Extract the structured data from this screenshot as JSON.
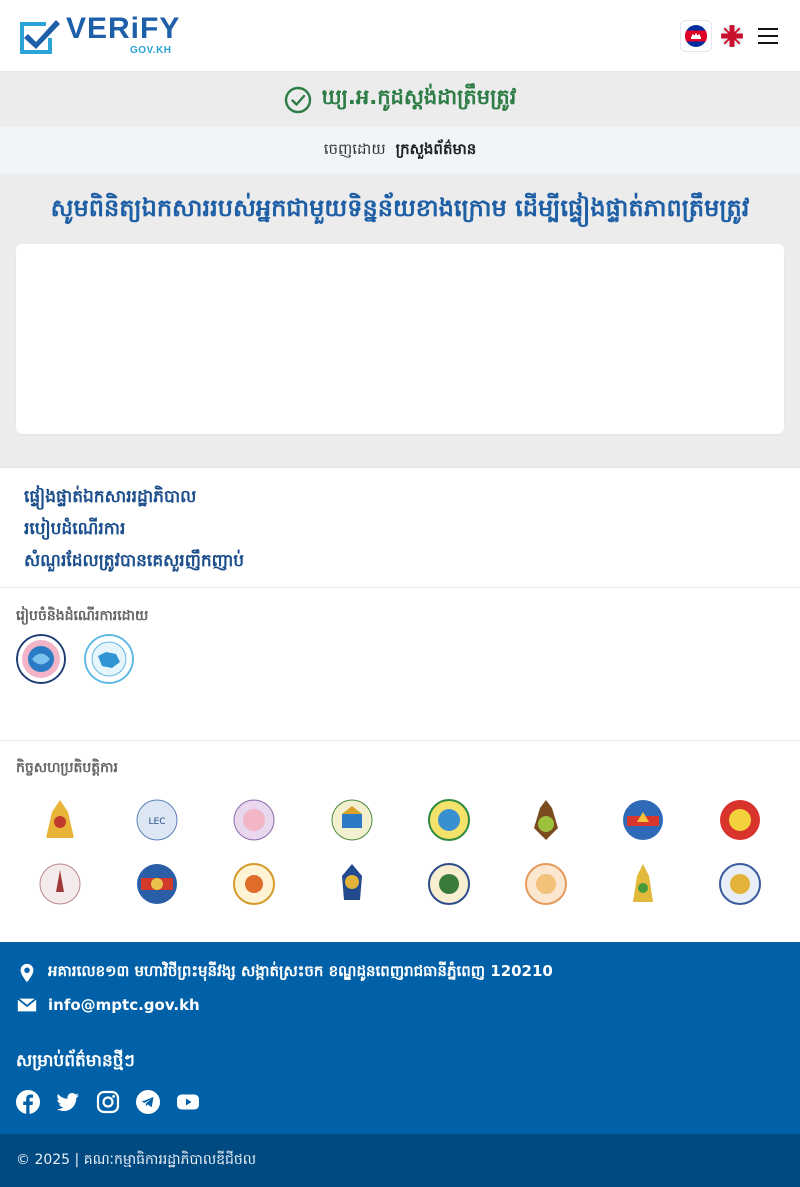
{
  "header": {
    "logo_text": "VERiFY",
    "logo_sub": "GOV.KH",
    "lang_kh": "flag-kh-icon",
    "lang_en": "flag-uk-icon"
  },
  "status": {
    "text": "ឃ្យ.អ.កូដស្តង់ដាត្រឹមត្រូវ",
    "color": "#2e7d46"
  },
  "issuer": {
    "label": "ចេញដោយ",
    "name": "ក្រសួងព័ត៌មាន"
  },
  "main": {
    "title": "សូមពិនិត្យឯកសាររបស់អ្នកជាមួយទិន្នន័យខាងក្រោម ដើម្បីផ្ទៀងផ្ទាត់ភាពត្រឹមត្រូវ"
  },
  "links": [
    "ផ្ទៀងផ្ទាត់ឯកសាររដ្ឋាភិបាល",
    "របៀបដំណើរការ",
    "សំណួរដែលត្រូវបានគេសួរញឹកញាប់"
  ],
  "developed_by": {
    "label": "រៀបចំនិងដំណើរការដោយ"
  },
  "partners": {
    "label": "កិច្ចសហប្រតិបត្តិការ"
  },
  "footer": {
    "address": "អគារលេខ១៣ មហាវិថីព្រះមុនីវង្ស សង្កាត់ស្រះចក ខណ្ឌដូនពេញរាជធានីភ្នំពេញ 120210",
    "email": "info@mptc.gov.kh",
    "follow_label": "សម្រាប់ព័ត៌មានថ្មីៗ",
    "socials": [
      "facebook-icon",
      "twitter-icon",
      "instagram-icon",
      "telegram-icon",
      "youtube-icon"
    ],
    "copyright": "© 2025 | គណៈកម្មាធិការរដ្ឋាភិបាលឌីជីថល",
    "bg_color": "#0060a8"
  }
}
